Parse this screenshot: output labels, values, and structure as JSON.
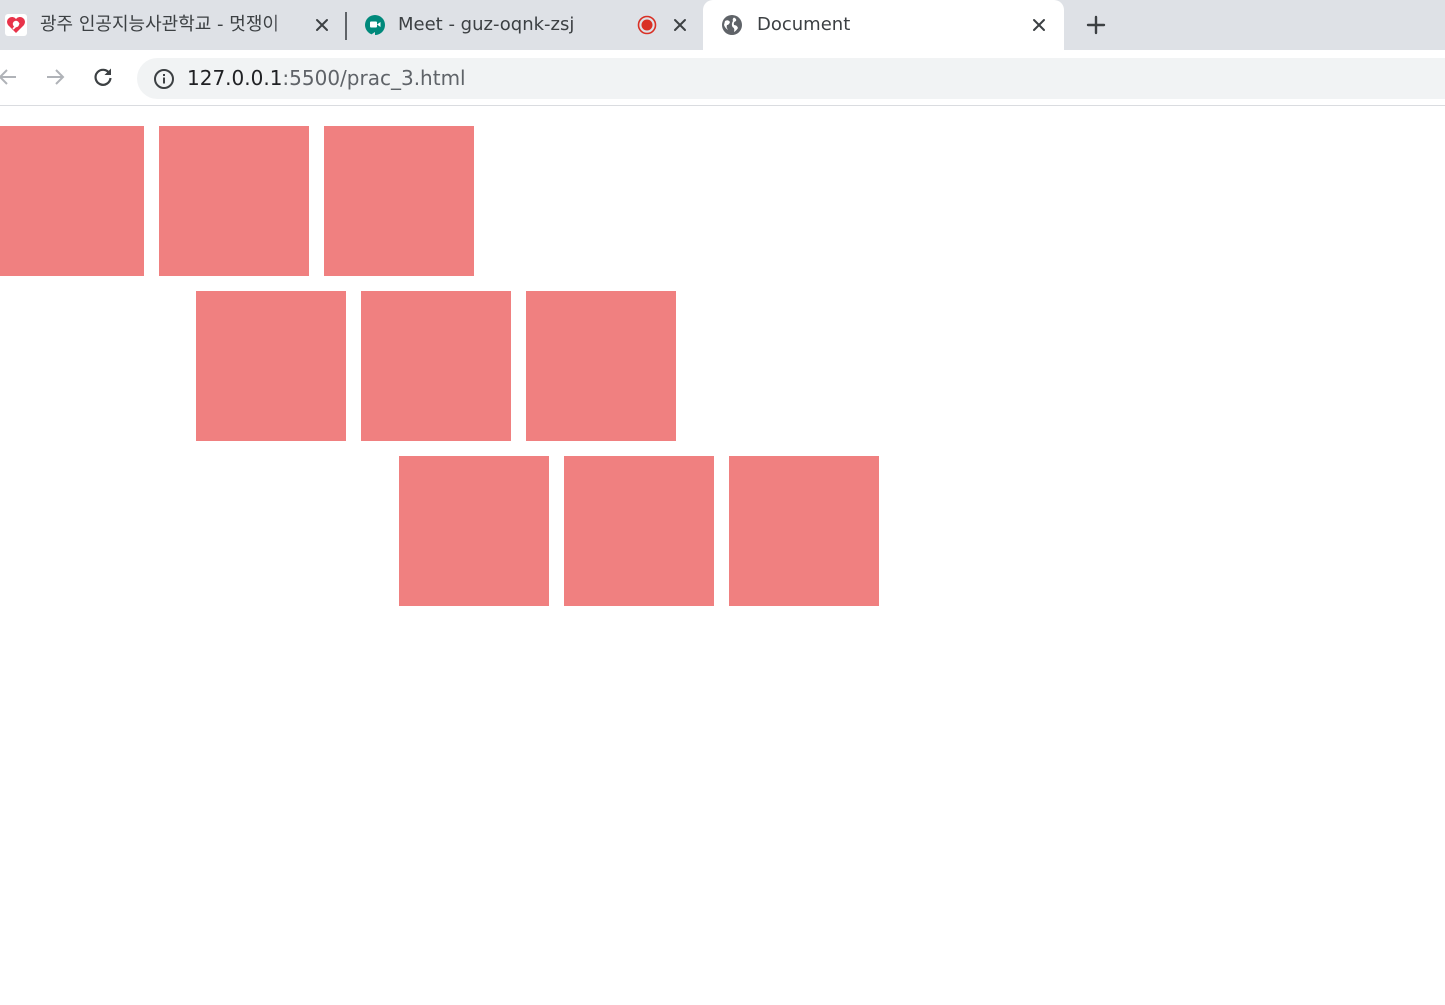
{
  "browser": {
    "tabs": [
      {
        "title": "광주 인공지능사관학교 - 멋쟁이",
        "favicon": "heart-logo-icon",
        "close_icon": "close-icon"
      },
      {
        "title": "Meet - guz-oqnk-zsj",
        "favicon": "google-meet-icon",
        "recording_indicator": "recording-dot-icon",
        "close_icon": "close-icon"
      },
      {
        "title": "Document",
        "favicon": "globe-icon",
        "close_icon": "close-icon",
        "active": true
      }
    ],
    "new_tab_icon": "plus-icon",
    "toolbar": {
      "back_icon": "arrow-left-icon",
      "forward_icon": "arrow-right-icon",
      "reload_icon": "reload-icon",
      "info_icon": "info-icon",
      "url_host": "127.0.0.1",
      "url_path": ":5500/prac_3.html"
    }
  },
  "page": {
    "box_color": "#f08080",
    "rows": [
      {
        "boxes": 3
      },
      {
        "boxes": 3
      },
      {
        "boxes": 3
      }
    ]
  }
}
